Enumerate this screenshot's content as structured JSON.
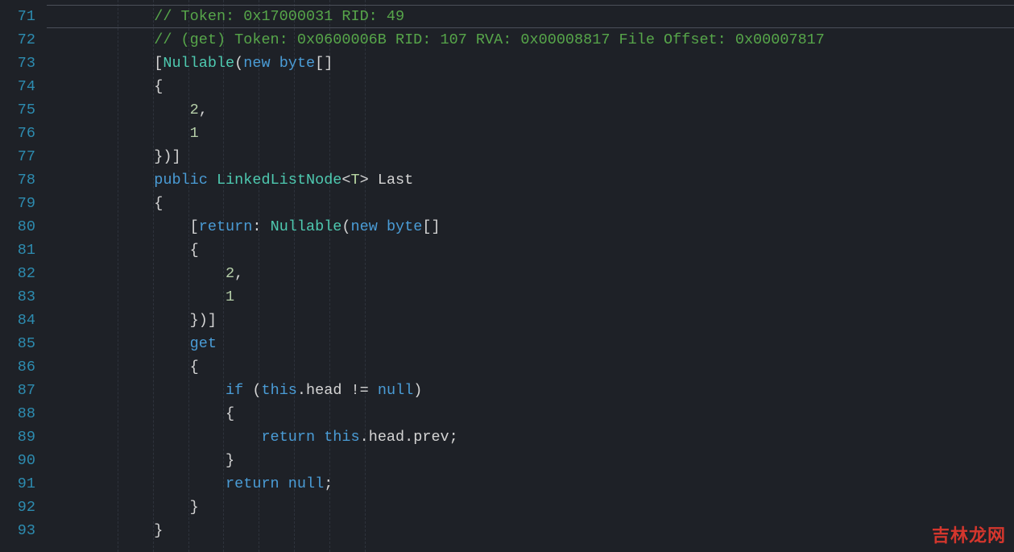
{
  "gutter": {
    "start": 71,
    "end": 93
  },
  "code": {
    "lines": [
      {
        "n": 71,
        "indent": 3,
        "tokens": [
          {
            "t": "// Token: 0x17000031 RID: 49",
            "c": "cmt"
          }
        ]
      },
      {
        "n": 72,
        "indent": 3,
        "tokens": [
          {
            "t": "// (get) Token: 0x0600006B RID: 107 RVA: 0x00008817 File Offset: 0x00007817",
            "c": "cmt"
          }
        ]
      },
      {
        "n": 73,
        "indent": 3,
        "tokens": [
          {
            "t": "[",
            "c": "punc"
          },
          {
            "t": "Nullable",
            "c": "typ"
          },
          {
            "t": "(",
            "c": "punc"
          },
          {
            "t": "new",
            "c": "kw"
          },
          {
            "t": " ",
            "c": "punc"
          },
          {
            "t": "byte",
            "c": "kw"
          },
          {
            "t": "[]",
            "c": "punc"
          }
        ]
      },
      {
        "n": 74,
        "indent": 3,
        "tokens": [
          {
            "t": "{",
            "c": "punc"
          }
        ]
      },
      {
        "n": 75,
        "indent": 4,
        "tokens": [
          {
            "t": "2",
            "c": "num"
          },
          {
            "t": ",",
            "c": "punc"
          }
        ]
      },
      {
        "n": 76,
        "indent": 4,
        "tokens": [
          {
            "t": "1",
            "c": "num"
          }
        ]
      },
      {
        "n": 77,
        "indent": 3,
        "tokens": [
          {
            "t": "})]",
            "c": "punc"
          }
        ]
      },
      {
        "n": 78,
        "indent": 3,
        "tokens": [
          {
            "t": "public",
            "c": "kw"
          },
          {
            "t": " ",
            "c": "punc"
          },
          {
            "t": "LinkedListNode",
            "c": "typ"
          },
          {
            "t": "<",
            "c": "punc"
          },
          {
            "t": "T",
            "c": "gen"
          },
          {
            "t": ">",
            "c": "punc"
          },
          {
            "t": " ",
            "c": "punc"
          },
          {
            "t": "Last",
            "c": "ident"
          }
        ]
      },
      {
        "n": 79,
        "indent": 3,
        "tokens": [
          {
            "t": "{",
            "c": "punc"
          }
        ]
      },
      {
        "n": 80,
        "indent": 4,
        "tokens": [
          {
            "t": "[",
            "c": "punc"
          },
          {
            "t": "return",
            "c": "kw"
          },
          {
            "t": ": ",
            "c": "punc"
          },
          {
            "t": "Nullable",
            "c": "typ"
          },
          {
            "t": "(",
            "c": "punc"
          },
          {
            "t": "new",
            "c": "kw"
          },
          {
            "t": " ",
            "c": "punc"
          },
          {
            "t": "byte",
            "c": "kw"
          },
          {
            "t": "[]",
            "c": "punc"
          }
        ]
      },
      {
        "n": 81,
        "indent": 4,
        "tokens": [
          {
            "t": "{",
            "c": "punc"
          }
        ]
      },
      {
        "n": 82,
        "indent": 5,
        "tokens": [
          {
            "t": "2",
            "c": "num"
          },
          {
            "t": ",",
            "c": "punc"
          }
        ]
      },
      {
        "n": 83,
        "indent": 5,
        "tokens": [
          {
            "t": "1",
            "c": "num"
          }
        ]
      },
      {
        "n": 84,
        "indent": 4,
        "tokens": [
          {
            "t": "})]",
            "c": "punc"
          }
        ]
      },
      {
        "n": 85,
        "indent": 4,
        "tokens": [
          {
            "t": "get",
            "c": "kw"
          }
        ]
      },
      {
        "n": 86,
        "indent": 4,
        "tokens": [
          {
            "t": "{",
            "c": "punc"
          }
        ]
      },
      {
        "n": 87,
        "indent": 5,
        "tokens": [
          {
            "t": "if",
            "c": "kw"
          },
          {
            "t": " (",
            "c": "punc"
          },
          {
            "t": "this",
            "c": "kw"
          },
          {
            "t": ".",
            "c": "punc"
          },
          {
            "t": "head",
            "c": "ident"
          },
          {
            "t": " != ",
            "c": "op"
          },
          {
            "t": "null",
            "c": "kw"
          },
          {
            "t": ")",
            "c": "punc"
          }
        ]
      },
      {
        "n": 88,
        "indent": 5,
        "tokens": [
          {
            "t": "{",
            "c": "punc"
          }
        ]
      },
      {
        "n": 89,
        "indent": 6,
        "tokens": [
          {
            "t": "return",
            "c": "kw"
          },
          {
            "t": " ",
            "c": "punc"
          },
          {
            "t": "this",
            "c": "kw"
          },
          {
            "t": ".",
            "c": "punc"
          },
          {
            "t": "head",
            "c": "ident"
          },
          {
            "t": ".",
            "c": "punc"
          },
          {
            "t": "prev",
            "c": "ident"
          },
          {
            "t": ";",
            "c": "punc"
          }
        ]
      },
      {
        "n": 90,
        "indent": 5,
        "tokens": [
          {
            "t": "}",
            "c": "punc"
          }
        ]
      },
      {
        "n": 91,
        "indent": 5,
        "tokens": [
          {
            "t": "return",
            "c": "kw"
          },
          {
            "t": " ",
            "c": "punc"
          },
          {
            "t": "null",
            "c": "kw"
          },
          {
            "t": ";",
            "c": "punc"
          }
        ]
      },
      {
        "n": 92,
        "indent": 4,
        "tokens": [
          {
            "t": "}",
            "c": "punc"
          }
        ]
      },
      {
        "n": 93,
        "indent": 3,
        "tokens": [
          {
            "t": "}",
            "c": "punc"
          }
        ]
      }
    ]
  },
  "watermark": "吉林龙网",
  "highlight_line": 71
}
